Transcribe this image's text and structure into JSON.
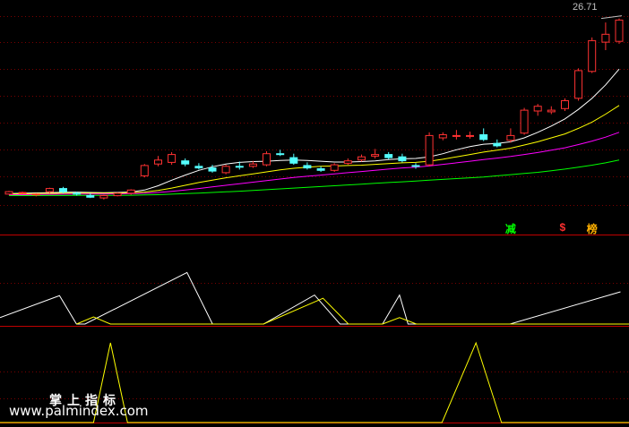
{
  "chart_data": {
    "type": "candlestick",
    "main": {
      "price_label": "26.71",
      "ylim": [
        3,
        27
      ],
      "candles": [
        [
          4.5,
          4.9,
          4.4,
          4.8
        ],
        [
          4.6,
          4.8,
          4.5,
          4.7
        ],
        [
          4.4,
          4.6,
          4.2,
          4.5
        ],
        [
          4.8,
          5.3,
          4.6,
          5.2
        ],
        [
          5.2,
          5.4,
          4.6,
          4.8
        ],
        [
          4.6,
          4.8,
          4.3,
          4.5
        ],
        [
          4.3,
          4.6,
          4.0,
          4.1
        ],
        [
          4.0,
          4.4,
          3.8,
          4.3
        ],
        [
          4.3,
          4.7,
          4.2,
          4.6
        ],
        [
          4.6,
          5.1,
          4.4,
          5.0
        ],
        [
          6.8,
          8.3,
          6.6,
          8.1
        ],
        [
          8.3,
          9.3,
          8.0,
          8.8
        ],
        [
          8.5,
          9.8,
          8.2,
          9.5
        ],
        [
          8.7,
          9.0,
          8.0,
          8.3
        ],
        [
          8.0,
          8.4,
          7.6,
          7.8
        ],
        [
          7.8,
          8.2,
          7.2,
          7.4
        ],
        [
          7.2,
          8.2,
          7.0,
          8.0
        ],
        [
          8.0,
          8.6,
          7.6,
          7.9
        ],
        [
          8.0,
          8.7,
          7.8,
          8.3
        ],
        [
          8.2,
          9.9,
          8.0,
          9.6
        ],
        [
          9.6,
          10.1,
          9.3,
          9.5
        ],
        [
          9.1,
          9.6,
          8.2,
          8.4
        ],
        [
          8.1,
          8.5,
          7.6,
          7.8
        ],
        [
          7.7,
          8.0,
          7.3,
          7.5
        ],
        [
          7.5,
          8.4,
          7.3,
          8.2
        ],
        [
          8.4,
          9.0,
          8.2,
          8.7
        ],
        [
          8.8,
          9.5,
          8.6,
          9.2
        ],
        [
          9.3,
          10.2,
          9.0,
          9.5
        ],
        [
          9.5,
          9.8,
          8.9,
          9.1
        ],
        [
          9.2,
          9.6,
          8.5,
          8.7
        ],
        [
          8.1,
          8.4,
          7.7,
          8.0
        ],
        [
          8.2,
          12.3,
          8.0,
          11.9
        ],
        [
          11.6,
          12.3,
          11.3,
          12.0
        ],
        [
          11.8,
          12.6,
          11.4,
          11.9
        ],
        [
          11.8,
          12.4,
          11.5,
          11.9
        ],
        [
          12.0,
          12.8,
          11.2,
          11.4
        ],
        [
          10.9,
          11.4,
          10.4,
          10.6
        ],
        [
          11.3,
          12.8,
          11.0,
          11.9
        ],
        [
          12.2,
          15.4,
          12.0,
          15.1
        ],
        [
          15.0,
          15.9,
          14.4,
          15.6
        ],
        [
          14.9,
          15.6,
          14.6,
          15.1
        ],
        [
          15.3,
          16.6,
          15.0,
          16.3
        ],
        [
          16.6,
          20.4,
          16.3,
          20.1
        ],
        [
          20.0,
          24.3,
          19.8,
          23.9
        ],
        [
          23.7,
          26.2,
          22.7,
          24.7
        ],
        [
          23.8,
          26.71,
          23.5,
          26.5
        ]
      ],
      "ma_series": [
        {
          "color": "#ffffff",
          "values": [
            4.55,
            4.6,
            4.64,
            4.68,
            4.72,
            4.74,
            4.7,
            4.68,
            4.7,
            4.75,
            5.0,
            5.55,
            6.25,
            6.9,
            7.5,
            7.95,
            8.3,
            8.5,
            8.6,
            8.65,
            8.75,
            8.8,
            8.75,
            8.65,
            8.55,
            8.55,
            8.6,
            8.7,
            8.85,
            8.95,
            9.0,
            9.2,
            9.6,
            10.1,
            10.5,
            10.8,
            10.9,
            11.1,
            11.6,
            12.3,
            13.1,
            14.0,
            15.2,
            16.6,
            18.3,
            20.3
          ]
        },
        {
          "color": "#ffff00",
          "values": [
            4.5,
            4.52,
            4.55,
            4.58,
            4.6,
            4.62,
            4.62,
            4.62,
            4.63,
            4.66,
            4.75,
            4.95,
            5.25,
            5.6,
            5.95,
            6.25,
            6.55,
            6.8,
            7.05,
            7.3,
            7.55,
            7.75,
            7.9,
            8.0,
            8.05,
            8.1,
            8.15,
            8.25,
            8.35,
            8.45,
            8.5,
            8.65,
            8.9,
            9.2,
            9.5,
            9.8,
            10.05,
            10.3,
            10.7,
            11.1,
            11.6,
            12.1,
            12.8,
            13.6,
            14.6,
            15.7
          ]
        },
        {
          "color": "#ff00ff",
          "values": [
            4.4,
            4.42,
            4.44,
            4.46,
            4.48,
            4.5,
            4.5,
            4.5,
            4.52,
            4.55,
            4.6,
            4.7,
            4.85,
            5.0,
            5.2,
            5.4,
            5.6,
            5.8,
            6.0,
            6.2,
            6.4,
            6.6,
            6.75,
            6.9,
            7.05,
            7.2,
            7.35,
            7.5,
            7.65,
            7.8,
            7.9,
            8.05,
            8.25,
            8.45,
            8.65,
            8.85,
            9.05,
            9.25,
            9.5,
            9.75,
            10.05,
            10.35,
            10.75,
            11.2,
            11.7,
            12.3
          ]
        },
        {
          "color": "#00ff00",
          "values": [
            4.3,
            4.3,
            4.3,
            4.31,
            4.31,
            4.32,
            4.32,
            4.32,
            4.33,
            4.35,
            4.38,
            4.42,
            4.48,
            4.55,
            4.62,
            4.7,
            4.78,
            4.86,
            4.95,
            5.05,
            5.15,
            5.25,
            5.35,
            5.45,
            5.55,
            5.65,
            5.75,
            5.85,
            5.95,
            6.05,
            6.15,
            6.25,
            6.35,
            6.45,
            6.55,
            6.65,
            6.8,
            6.95,
            7.1,
            7.25,
            7.45,
            7.65,
            7.9,
            8.15,
            8.45,
            8.8
          ]
        }
      ],
      "markers": [
        {
          "text": "减",
          "candle": 37,
          "color": "#00ff00"
        },
        {
          "text": "$",
          "candle": 41,
          "color": "#ff3030"
        },
        {
          "text": "榜",
          "candle": 43,
          "color": "#ffb000"
        }
      ]
    },
    "panel2": {
      "ylim": [
        0,
        100
      ],
      "white": [
        [
          0,
          10
        ],
        [
          7,
          44
        ],
        [
          9,
          0
        ],
        [
          10,
          0
        ],
        [
          22,
          80
        ],
        [
          25,
          0
        ],
        [
          31,
          0
        ],
        [
          37,
          45
        ],
        [
          40,
          0
        ],
        [
          45,
          0
        ],
        [
          47,
          45
        ],
        [
          48,
          0
        ],
        [
          60,
          0
        ],
        [
          73,
          50
        ]
      ],
      "yellow": [
        [
          9,
          0
        ],
        [
          11,
          11
        ],
        [
          13,
          0
        ],
        [
          24,
          0
        ],
        [
          31,
          0
        ],
        [
          38,
          40
        ],
        [
          41,
          0
        ],
        [
          45,
          0
        ],
        [
          47,
          10
        ],
        [
          49,
          0
        ],
        [
          74,
          0
        ]
      ]
    },
    "panel3": {
      "ylim": [
        0,
        100
      ],
      "yellow": [
        [
          0,
          0
        ],
        [
          11,
          0
        ],
        [
          13,
          100
        ],
        [
          15,
          0
        ],
        [
          52,
          0
        ],
        [
          56,
          100
        ],
        [
          59,
          0
        ],
        [
          74,
          0
        ]
      ]
    }
  },
  "watermark": {
    "line1": "掌上指标",
    "line2": "www.palmindex.com"
  }
}
